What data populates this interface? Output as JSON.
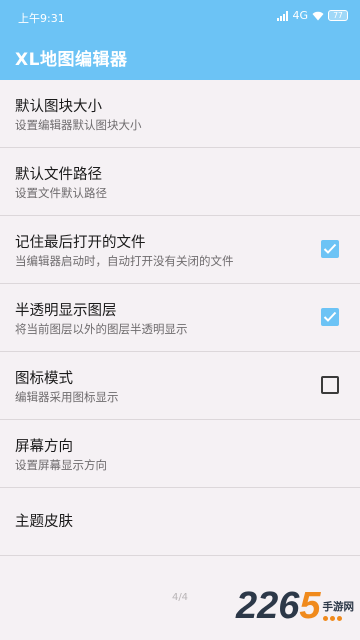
{
  "status_bar": {
    "time": "上午9:31",
    "network": "4G",
    "battery": "77"
  },
  "app_bar": {
    "title": "XL地图编辑器"
  },
  "preferences": [
    {
      "title": "默认图块大小",
      "summary": "设置编辑器默认图块大小"
    },
    {
      "title": "默认文件路径",
      "summary": "设置文件默认路径"
    },
    {
      "title": "记住最后打开的文件",
      "summary": "当编辑器启动时，自动打开没有关闭的文件",
      "checked": true
    },
    {
      "title": "半透明显示图层",
      "summary": "将当前图层以外的图层半透明显示",
      "checked": true
    },
    {
      "title": "图标模式",
      "summary": "编辑器采用图标显示",
      "checked": false
    },
    {
      "title": "屏幕方向",
      "summary": "设置屏幕显示方向"
    },
    {
      "title": "主题皮肤"
    }
  ],
  "page_indicator": "4/4",
  "watermark": {
    "number_prefix": "226",
    "number_highlight": "5",
    "text": "手游网"
  },
  "colors": {
    "accent": "#6cc3f5",
    "background": "#f5f1f4",
    "watermark_orange": "#f08a1c",
    "watermark_dark": "#2c3848"
  },
  "icons": [
    "signal-icon",
    "wifi-icon",
    "battery-icon",
    "checkbox-checked-icon",
    "checkbox-unchecked-icon"
  ]
}
